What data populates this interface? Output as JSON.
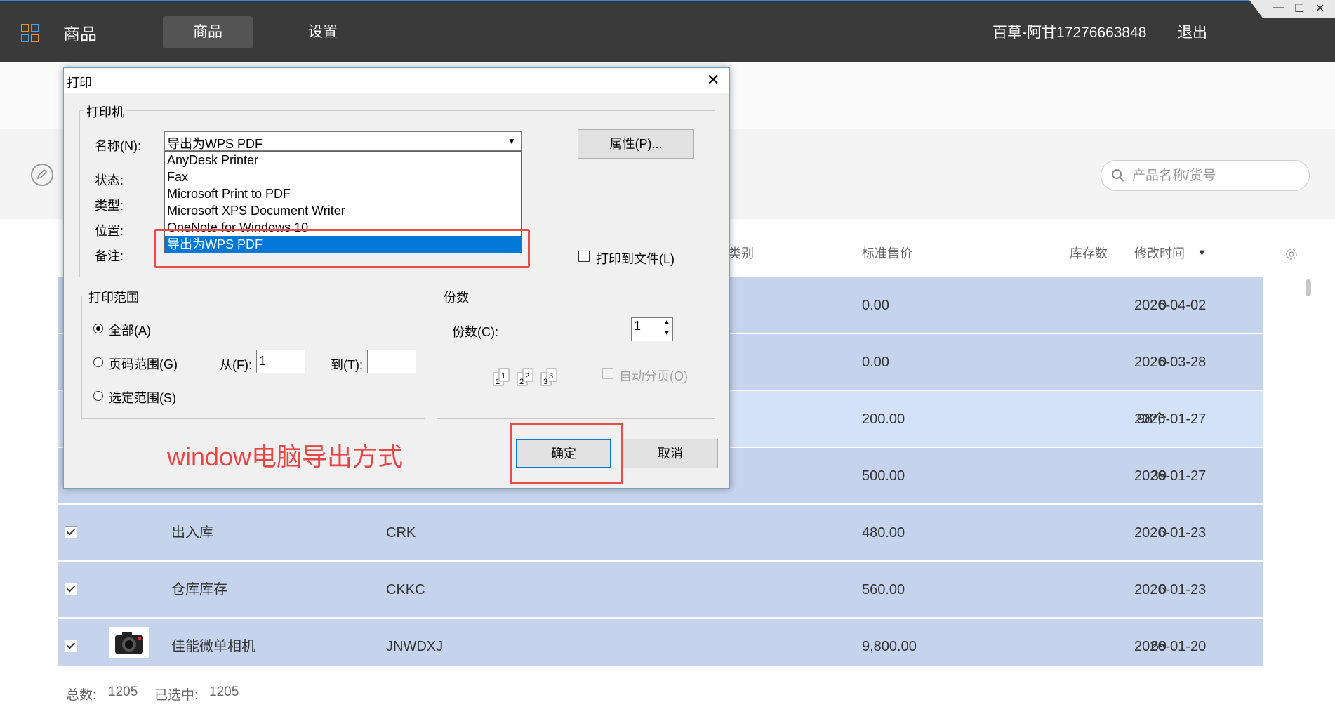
{
  "topbar": {
    "app_name": "商品",
    "tabs": [
      {
        "label": "商品",
        "active": true
      },
      {
        "label": "设置",
        "active": false
      }
    ],
    "user": "百草-阿甘17276663848",
    "logout": "退出",
    "window_controls": {
      "minimize": "—",
      "maximize": "☐",
      "close": "✕"
    }
  },
  "search": {
    "placeholder": "产品名称/货号",
    "value": ""
  },
  "table": {
    "headers": {
      "category": "类别",
      "price": "标准售价",
      "stock": "库存数",
      "modified": "修改时间",
      "sort_indicator": "▼"
    },
    "rows": [
      {
        "name": "",
        "code": "",
        "price": "0.00",
        "stock": "0",
        "modified": "2026-04-02",
        "checked": false,
        "highlight": false
      },
      {
        "name": "",
        "code": "",
        "price": "0.00",
        "stock": "0",
        "modified": "2026-03-28",
        "checked": false,
        "highlight": false
      },
      {
        "name": "",
        "code": "",
        "price": "200.00",
        "stock": "98个",
        "modified": "2026-01-27",
        "checked": false,
        "highlight": true
      },
      {
        "name": "",
        "code": "",
        "price": "500.00",
        "stock": "39",
        "modified": "2026-01-27",
        "checked": false,
        "highlight": false
      },
      {
        "name": "出入库",
        "code": "CRK",
        "price": "480.00",
        "stock": "0",
        "modified": "2026-01-23",
        "checked": true,
        "highlight": false
      },
      {
        "name": "仓库库存",
        "code": "CKKC",
        "price": "560.00",
        "stock": "0",
        "modified": "2026-01-23",
        "checked": true,
        "highlight": false
      },
      {
        "name": "佳能微单相机",
        "code": "JNWDXJ",
        "price": "9,800.00",
        "stock": "69",
        "modified": "2026-01-20",
        "checked": true,
        "highlight": false,
        "has_image": true
      }
    ]
  },
  "footer": {
    "total_label": "总数:",
    "total": "1205",
    "selected_label": "已选中:",
    "selected": "1205"
  },
  "print_dialog": {
    "title": "打印",
    "close": "✕",
    "printer_group": "打印机",
    "name_label": "名称(N):",
    "status_label": "状态:",
    "type_label": "类型:",
    "location_label": "位置:",
    "comment_label": "备注:",
    "selected_printer": "导出为WPS PDF",
    "printer_options": [
      "AnyDesk Printer",
      "Fax",
      "Microsoft Print to PDF",
      "Microsoft XPS Document Writer",
      "OneNote for Windows 10",
      "导出为WPS PDF"
    ],
    "properties_button": "属性(P)...",
    "print_to_file": "打印到文件(L)",
    "range_group": "打印范围",
    "range_all": "全部(A)",
    "range_pages": "页码范围(G)",
    "range_selection": "选定范围(S)",
    "from_label": "从(F):",
    "from_value": "1",
    "to_label": "到(T):",
    "to_value": "",
    "copies_group": "份数",
    "copies_label": "份数(C):",
    "copies_value": "1",
    "collate": "自动分页(O)",
    "ok_button": "确定",
    "cancel_button": "取消"
  },
  "annotation": "window电脑导出方式",
  "colors": {
    "accent": "#0078d7",
    "annotation": "#e84545",
    "row_bg": "#c5d4ec",
    "row_highlight": "#d4e2f9",
    "topbar_bg": "#3a3a3a"
  }
}
